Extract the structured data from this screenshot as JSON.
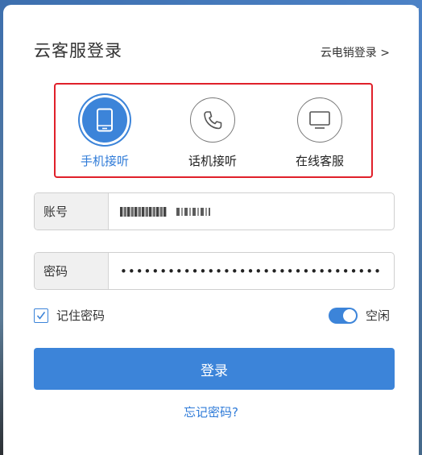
{
  "header": {
    "title": "云客服登录",
    "switch_link": "云电销登录 >"
  },
  "modes": [
    {
      "label": "手机接听",
      "icon": "mobile-phone-icon",
      "active": true
    },
    {
      "label": "话机接听",
      "icon": "telephone-icon",
      "active": false
    },
    {
      "label": "在线客服",
      "icon": "monitor-icon",
      "active": false
    }
  ],
  "form": {
    "account_label": "账号",
    "password_label": "密码",
    "password_value": "•••••••••••••••••••••••••••••••••"
  },
  "options": {
    "remember_label": "记住密码",
    "remember_checked": true,
    "status_label": "空闲",
    "status_on": true
  },
  "actions": {
    "login_label": "登录",
    "forgot_label": "忘记密码?"
  },
  "colors": {
    "accent": "#3c84d9",
    "highlight_border": "#e0202a"
  }
}
